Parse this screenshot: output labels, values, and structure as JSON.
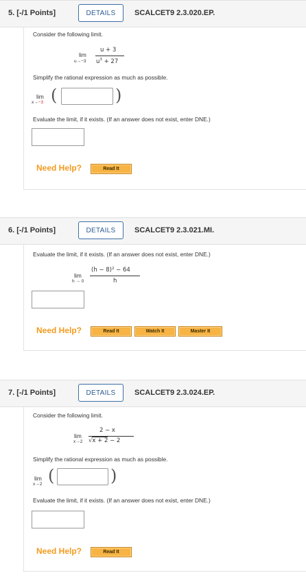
{
  "q5": {
    "number": "5.  [-/1 Points]",
    "details": "DETAILS",
    "code": "SCALCET9 2.3.020.EP.",
    "intro": "Consider the following limit.",
    "lim": "lim",
    "lim_sub_prefix": "u→",
    "lim_sub_val": "−3",
    "numerator": "u + 3",
    "den_u": "u",
    "den_exp": "3",
    "den_rest": " + 27",
    "simplify": "Simplify the rational expression as much as possible.",
    "lim2": "lim",
    "lim2_sub_prefix": "x→",
    "lim2_sub_val": "−3",
    "evaluate": "Evaluate the limit, if it exists. (If an answer does not exist, enter DNE.)",
    "need_help": "Need Help?",
    "read_it": "Read It"
  },
  "q6": {
    "number": "6.  [-/1 Points]",
    "details": "DETAILS",
    "code": "SCALCET9 2.3.021.MI.",
    "evaluate": "Evaluate the limit, if it exists. (If an answer does not exist, enter DNE.)",
    "lim": "lim",
    "lim_sub": "h → 0",
    "num_a": "(h − 8)",
    "num_exp": "2",
    "num_b": " − 64",
    "denominator": "h",
    "need_help": "Need Help?",
    "read_it": "Read It",
    "watch_it": "Watch It",
    "master_it": "Master It"
  },
  "q7": {
    "number": "7.  [-/1 Points]",
    "details": "DETAILS",
    "code": "SCALCET9 2.3.024.EP.",
    "intro": "Consider the following limit.",
    "lim": "lim",
    "lim_sub": "x→2",
    "numerator": "2 − x",
    "den_sqrt": "√",
    "den_radicand": "x + 2",
    "den_rest": " − 2",
    "simplify": "Simplify the rational expression as much as possible.",
    "lim2": "lim",
    "lim2_sub": "x→2",
    "evaluate": "Evaluate the limit, if it exists. (If an answer does not exist, enter DNE.)",
    "need_help": "Need Help?",
    "read_it": "Read It"
  },
  "colors": {
    "accent": "#2a5a91",
    "help_orange": "#f29b1e",
    "button_orange": "#f7b445",
    "math_red": "#d62b2b"
  }
}
